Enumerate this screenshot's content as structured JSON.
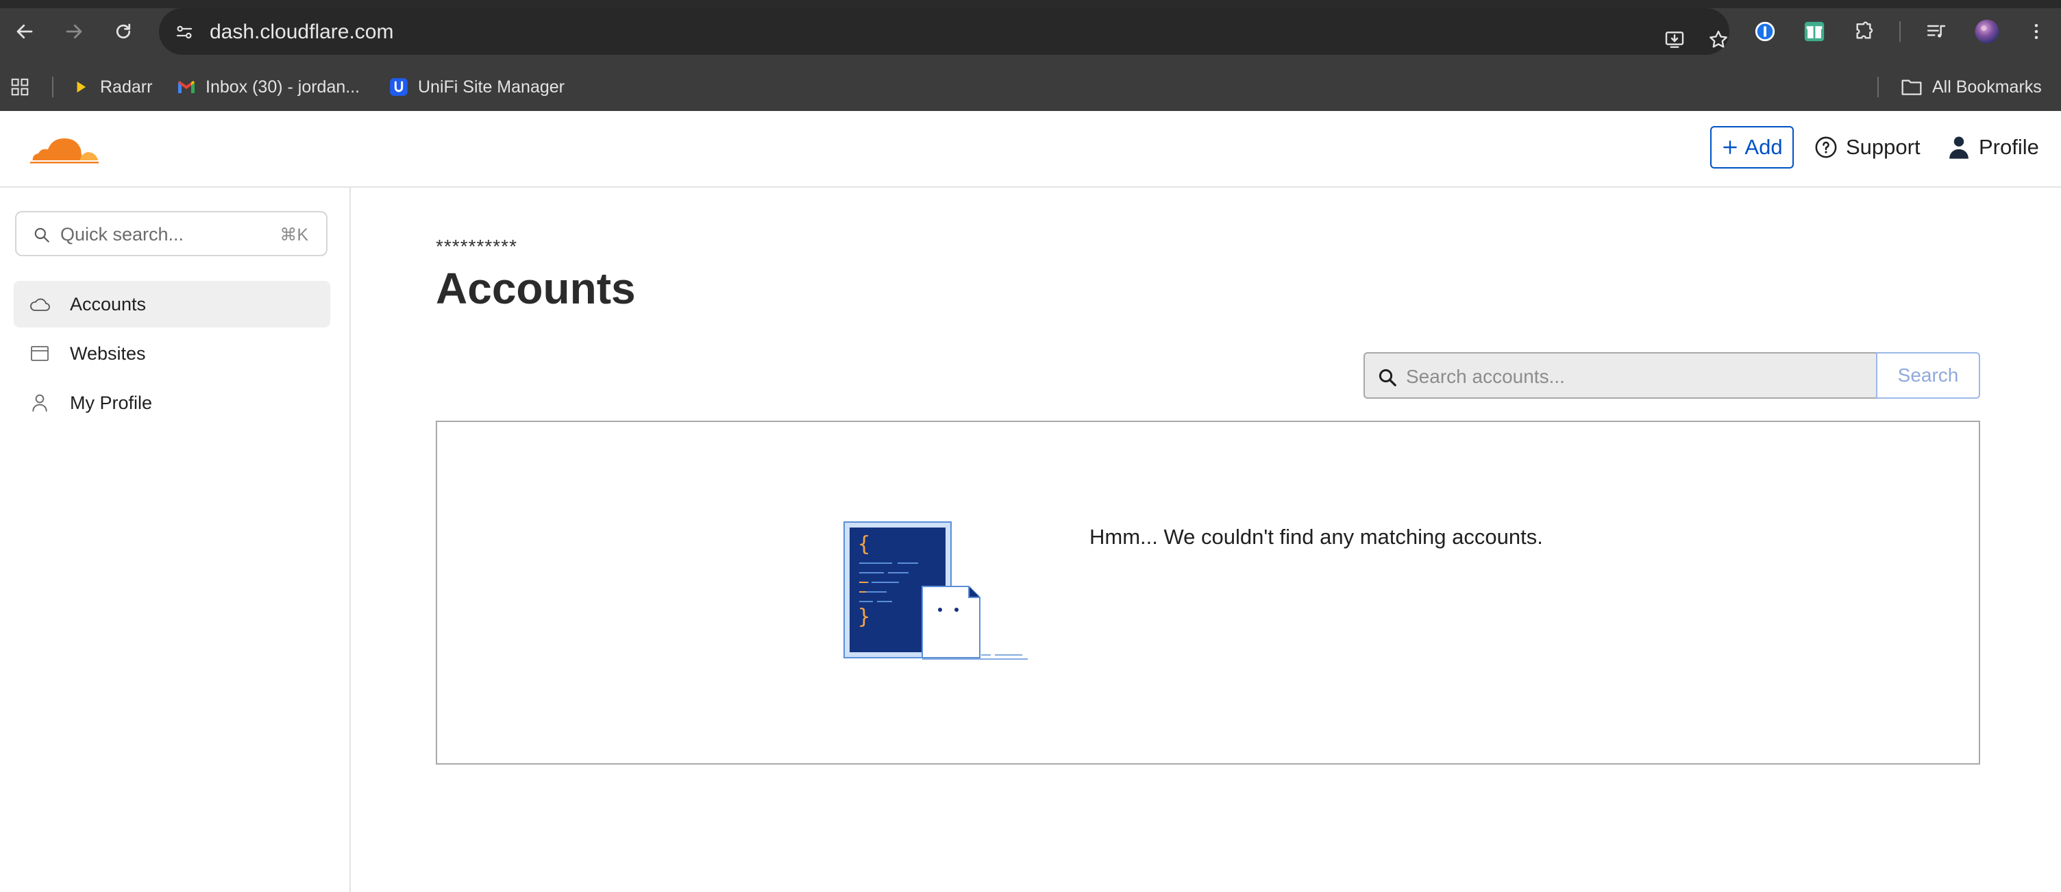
{
  "browser": {
    "url": "dash.cloudflare.com",
    "bookmarks": [
      {
        "label": "Radarr",
        "icon": "radarr-icon"
      },
      {
        "label": "Inbox (30) - jordan...",
        "icon": "gmail-icon"
      },
      {
        "label": "UniFi Site Manager",
        "icon": "unifi-icon"
      }
    ],
    "all_bookmarks_label": "All Bookmarks"
  },
  "header": {
    "add_label": "Add",
    "support_label": "Support",
    "profile_label": "Profile",
    "brand_color": "#f38020",
    "accent_color": "#0051c3"
  },
  "sidebar": {
    "search_placeholder": "Quick search...",
    "search_shortcut": "⌘K",
    "items": [
      {
        "label": "Accounts",
        "icon": "cloud-icon",
        "active": true
      },
      {
        "label": "Websites",
        "icon": "browser-window-icon",
        "active": false
      },
      {
        "label": "My Profile",
        "icon": "user-icon",
        "active": false
      }
    ]
  },
  "main": {
    "breadcrumb": "**********",
    "title": "Accounts",
    "search_placeholder": "Search accounts...",
    "search_button": "Search",
    "empty_message": "Hmm... We couldn't find any matching accounts."
  }
}
